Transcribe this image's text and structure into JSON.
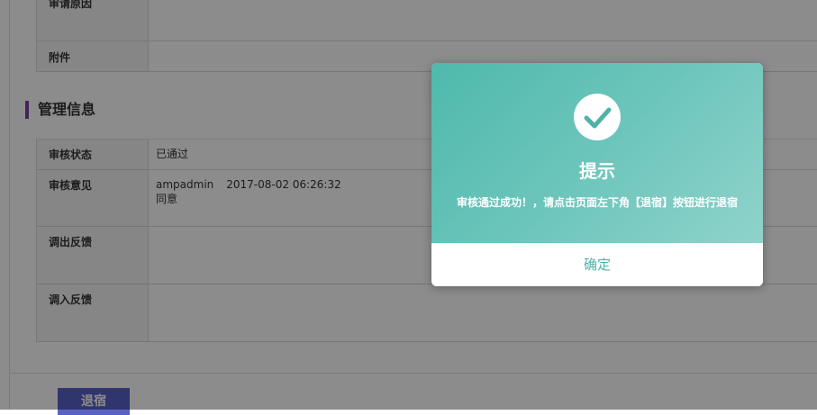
{
  "top_rows": [
    {
      "label": "审请原因",
      "value": ""
    },
    {
      "label": "附件",
      "value": ""
    }
  ],
  "management": {
    "title": "管理信息",
    "rows": [
      {
        "label": "审核状态",
        "value": "已通过"
      },
      {
        "label": "审核意见",
        "user": "ampadmin",
        "time": "2017-08-02 06:26:32",
        "comment": "同意"
      },
      {
        "label": "调出反馈",
        "value": ""
      },
      {
        "label": "调入反馈",
        "value": ""
      }
    ]
  },
  "return_button": "退宿",
  "dialog": {
    "icon": "check-circle-icon",
    "title": "提示",
    "message": "审核通过成功！，请点击页面左下角【退宿】按钮进行退宿",
    "ok_label": "确定"
  },
  "colors": {
    "accent_teal": "#4fb9ad",
    "section_bar": "#7b3fa0",
    "button_blue": "#5a62c8"
  }
}
